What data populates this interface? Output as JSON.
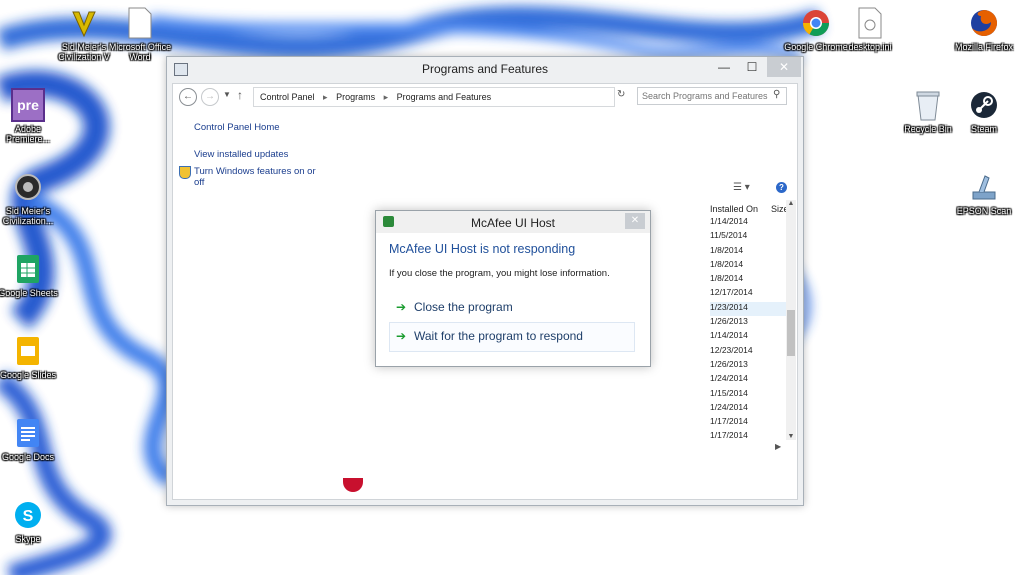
{
  "desktop": {
    "icons": [
      {
        "label": "Sid Meier's Civilization V",
        "icon": "civilization-v-icon",
        "color": "#d8b900"
      },
      {
        "label": "Microsoft Office Word",
        "icon": "document-icon",
        "color": "#ffffff"
      },
      {
        "label": "Adobe Premiere...",
        "icon": "premiere-icon",
        "color": "#9c6fc5"
      },
      {
        "label": "Sid Meier's Civilization...",
        "icon": "civilization-icon",
        "color": "#2a2a2a"
      },
      {
        "label": "Google Sheets",
        "icon": "sheets-icon",
        "color": "#1fa463"
      },
      {
        "label": "Google Slides",
        "icon": "slides-icon",
        "color": "#f4b400"
      },
      {
        "label": "Google Docs",
        "icon": "docs-icon",
        "color": "#4285f4"
      },
      {
        "label": "Skype",
        "icon": "skype-icon",
        "color": "#00aff0"
      },
      {
        "label": "Google Chrome",
        "icon": "chrome-icon",
        "color": "#db4437"
      },
      {
        "label": "desktop.ini",
        "icon": "file-icon",
        "color": "#ffffff"
      },
      {
        "label": "Mozilla Firefox",
        "icon": "firefox-icon",
        "color": "#e66000"
      },
      {
        "label": "Recycle Bin",
        "icon": "recycle-bin-icon",
        "color": "#e8eef5"
      },
      {
        "label": "Steam",
        "icon": "steam-icon",
        "color": "#1b2838"
      },
      {
        "label": "EPSON Scan",
        "icon": "scanner-icon",
        "color": "#7ea3c9"
      }
    ]
  },
  "window": {
    "title": "Programs and Features",
    "minimize": "—",
    "maximize": "☐",
    "close": "✕",
    "address": [
      "Control Panel",
      "Programs",
      "Programs and Features"
    ],
    "search_placeholder": "Search Programs and Features",
    "sidebar": {
      "home": "Control Panel Home",
      "updates": "View installed updates",
      "features_1": "Turn Windows features on or",
      "features_2": "off"
    },
    "columns": {
      "installed_on": "Installed On",
      "size": "Size"
    },
    "dates": [
      "1/14/2014",
      "11/5/2014",
      "1/8/2014",
      "1/8/2014",
      "1/8/2014",
      "12/17/2014",
      "1/23/2014",
      "1/26/2013",
      "1/14/2014",
      "12/23/2014",
      "1/26/2013",
      "1/24/2014",
      "1/15/2014",
      "1/24/2014",
      "1/17/2014",
      "1/17/2014"
    ]
  },
  "dialog": {
    "title": "McAfee UI Host",
    "heading": "McAfee UI Host is not responding",
    "message": "If you close the program, you might lose information.",
    "option_close": "Close the program",
    "option_wait": "Wait for the program to respond",
    "close": "✕"
  },
  "colors": {
    "accent": "#1f4f9a",
    "link": "#1b3e8e",
    "green_arrow": "#1a9c2f",
    "wallpaper_blue": "#1e5fd6"
  }
}
